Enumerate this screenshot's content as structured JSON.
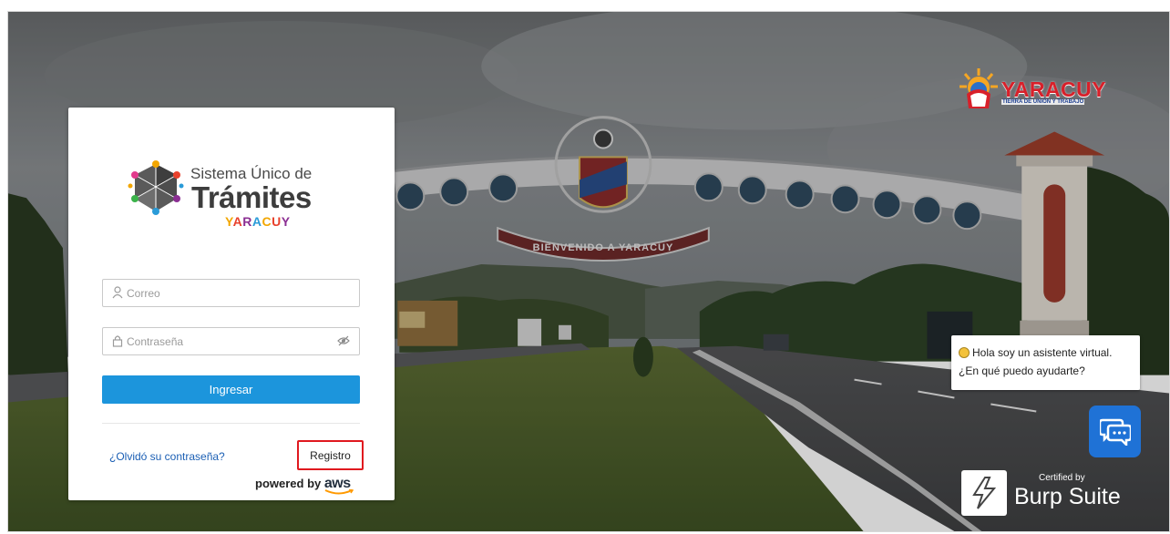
{
  "background": {
    "arch_banner_text": "BIENVENIDO A YARACUY"
  },
  "brand": {
    "name": "YARACUY",
    "tagline": "TIERRA DE UNIÓN Y TRABAJO"
  },
  "login": {
    "logo": {
      "line1": "Sistema Único de",
      "line2": "Trámites",
      "line3_parts": [
        "Y",
        "A",
        "R",
        "A",
        "C",
        "U",
        "Y"
      ],
      "line3": "YARACUY"
    },
    "email_placeholder": "Correo",
    "email_value": "",
    "email_icon": "user-icon",
    "password_placeholder": "Contraseña",
    "password_value": "",
    "password_icon": "lock-icon",
    "password_toggle_icon": "eye-off-icon",
    "submit_label": "Ingresar",
    "submit_color": "#1c95dc",
    "forgot_label": "¿Olvidó su contraseña?",
    "register_label": "Registro",
    "register_highlight_color": "#e0191f",
    "powered_by_label": "powered by",
    "aws_label": "aws"
  },
  "chat": {
    "greeting_line1": "Hola soy un asistente virtual.",
    "greeting_line2": "¿En qué puedo ayudarte?",
    "button_icon": "chat-bubbles-icon",
    "button_color": "#1f72d6"
  },
  "burp": {
    "certified_label": "Certified by",
    "name": "Burp Suite"
  }
}
